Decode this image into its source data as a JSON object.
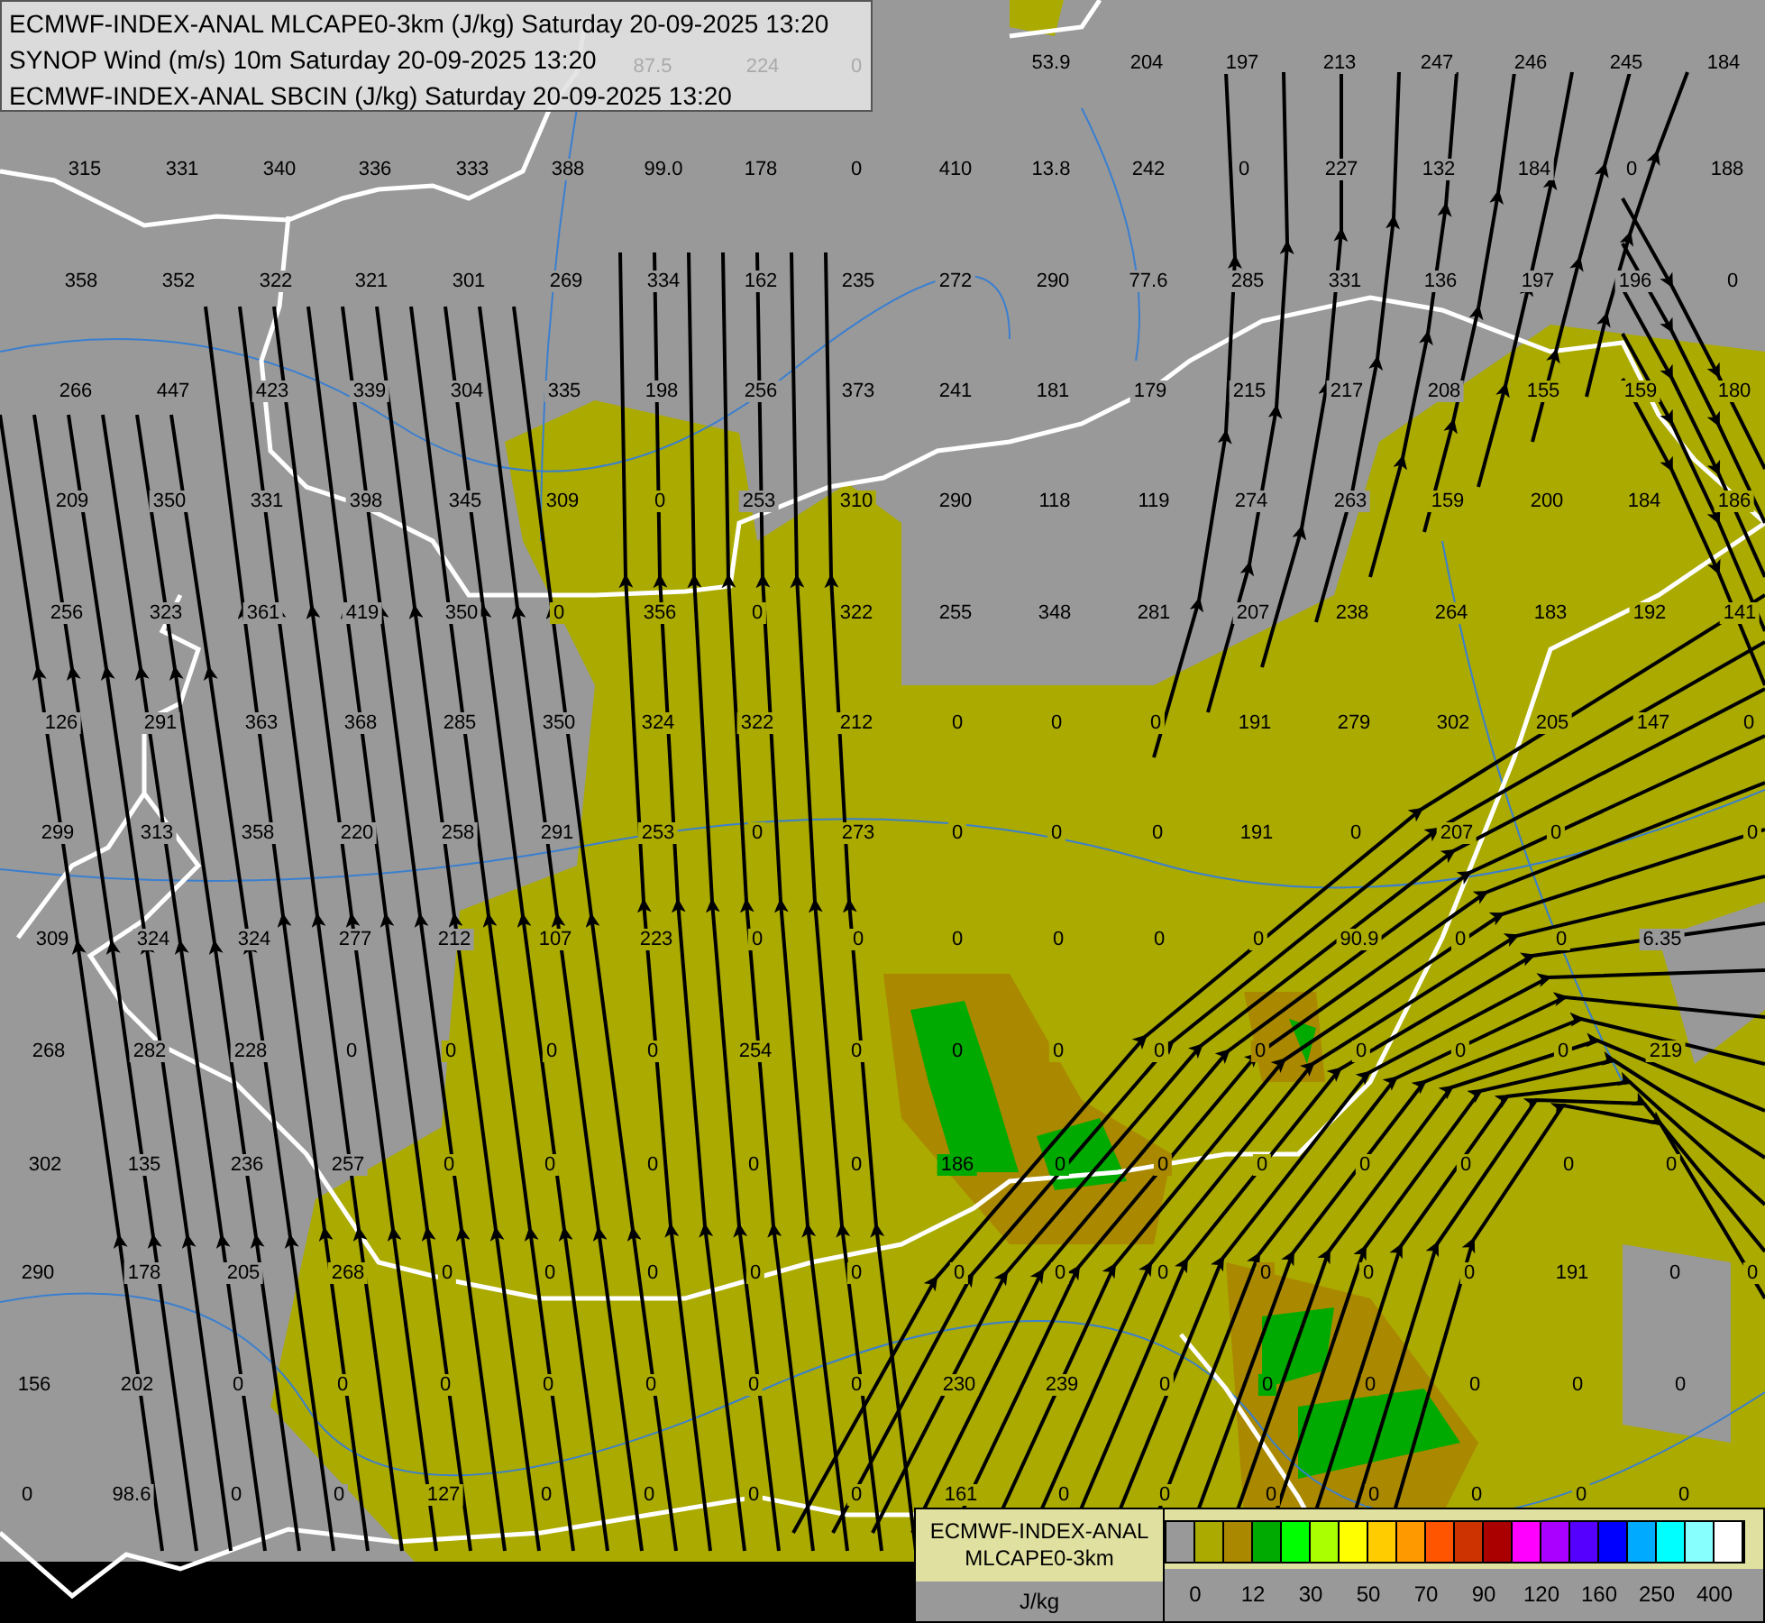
{
  "title_lines": [
    "ECMWF-INDEX-ANAL MLCAPE0-3km (J/kg) Saturday 20-09-2025 13:20",
    "SYNOP Wind (m/s) 10m Saturday 20-09-2025 13:20",
    "ECMWF-INDEX-ANAL SBCIN (J/kg) Saturday 20-09-2025 13:20"
  ],
  "values_behind_title": [
    "87.5",
    "224",
    "0"
  ],
  "value_rows": [
    [
      "53.9",
      "204",
      "197",
      "213",
      "247",
      "246",
      "245",
      "184"
    ],
    [
      "315",
      "331",
      "340",
      "336",
      "333",
      "388",
      "99.0",
      "178",
      "0",
      "410",
      "13.8",
      "242",
      "0",
      "227",
      "132",
      "184",
      "0",
      "188"
    ],
    [
      "358",
      "352",
      "322",
      "321",
      "301",
      "269",
      "334",
      "162",
      "235",
      "272",
      "290",
      "77.6",
      "285",
      "331",
      "136",
      "197",
      "196",
      "0"
    ],
    [
      "266",
      "447",
      "423",
      "339",
      "304",
      "335",
      "198",
      "256",
      "373",
      "241",
      "181",
      "179",
      "215",
      "217",
      "208",
      "155",
      "159",
      "180"
    ],
    [
      "209",
      "350",
      "331",
      "398",
      "345",
      "309",
      "0",
      "253",
      "310",
      "290",
      "118",
      "119",
      "274",
      "263",
      "159",
      "200",
      "184",
      "186"
    ],
    [
      "256",
      "323",
      "361",
      "419",
      "350",
      "0",
      "356",
      "0",
      "322",
      "255",
      "348",
      "281",
      "207",
      "238",
      "264",
      "183",
      "192",
      "141"
    ],
    [
      "126",
      "291",
      "363",
      "368",
      "285",
      "350",
      "324",
      "322",
      "212",
      "0",
      "0",
      "0",
      "191",
      "279",
      "302",
      "205",
      "147",
      "0"
    ],
    [
      "299",
      "313",
      "358",
      "220",
      "258",
      "291",
      "253",
      "0",
      "273",
      "0",
      "0",
      "0",
      "191",
      "0",
      "207",
      "0",
      "0"
    ],
    [
      "309",
      "324",
      "324",
      "277",
      "212",
      "107",
      "223",
      "0",
      "0",
      "0",
      "0",
      "0",
      "0",
      "90.9",
      "0",
      "0",
      "6.35"
    ],
    [
      "268",
      "282",
      "228",
      "0",
      "0",
      "0",
      "0",
      "254",
      "0",
      "0",
      "0",
      "0",
      "0",
      "0",
      "0",
      "0",
      "219"
    ],
    [
      "302",
      "135",
      "236",
      "257",
      "0",
      "0",
      "0",
      "0",
      "0",
      "186",
      "0",
      "0",
      "0",
      "0",
      "0",
      "0",
      "0"
    ],
    [
      "290",
      "178",
      "205",
      "268",
      "0",
      "0",
      "0",
      "0",
      "0",
      "0",
      "0",
      "0",
      "0",
      "0",
      "0",
      "191",
      "0",
      "0"
    ],
    [
      "156",
      "202",
      "0",
      "0",
      "0",
      "0",
      "0",
      "0",
      "0",
      "230",
      "239",
      "0",
      "0",
      "0",
      "0",
      "0",
      "0"
    ],
    [
      "0",
      "98.6",
      "0",
      "0",
      "127",
      "0",
      "0",
      "0",
      "0",
      "161",
      "0",
      "0",
      "0",
      "0",
      "0",
      "0",
      "0"
    ]
  ],
  "legend": {
    "title_lines": [
      "ECMWF-INDEX-ANAL",
      "MLCAPE0-3km"
    ],
    "unit": "J/kg",
    "swatches": [
      {
        "color": "#999999"
      },
      {
        "color": "#aaaa00"
      },
      {
        "color": "#aa8800"
      },
      {
        "color": "#00aa00"
      },
      {
        "color": "#00ff00"
      },
      {
        "color": "#aaff00"
      },
      {
        "color": "#ffff00"
      },
      {
        "color": "#ffcc00"
      },
      {
        "color": "#ff9900"
      },
      {
        "color": "#ff5500"
      },
      {
        "color": "#cc3300"
      },
      {
        "color": "#aa0000"
      },
      {
        "color": "#ff00ff"
      },
      {
        "color": "#aa00ff"
      },
      {
        "color": "#5500ff"
      },
      {
        "color": "#0000ff"
      },
      {
        "color": "#00aaff"
      },
      {
        "color": "#00ffff"
      },
      {
        "color": "#88ffff"
      },
      {
        "color": "#ffffff"
      }
    ],
    "ticks": [
      "0",
      "12",
      "30",
      "50",
      "70",
      "90",
      "120",
      "160",
      "250",
      "400"
    ]
  }
}
